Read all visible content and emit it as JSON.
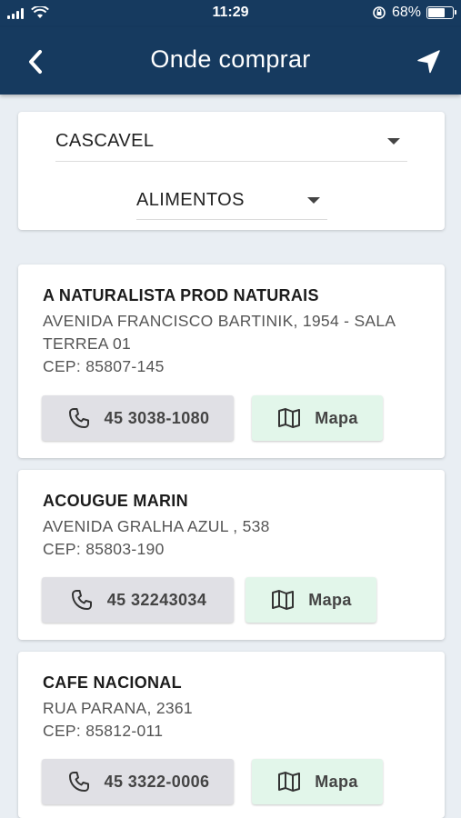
{
  "status_bar": {
    "time": "11:29",
    "battery": "68%",
    "battery_level": 0.68
  },
  "header": {
    "title": "Onde comprar",
    "back_icon": "chevron-left-icon",
    "location_icon": "navigation-arrow-icon"
  },
  "filters": {
    "city": "CASCAVEL",
    "category": "ALIMENTOS"
  },
  "stores": [
    {
      "name": "A NATURALISTA PROD NATURAIS",
      "address_line1": "AVENIDA FRANCISCO BARTINIK,  1954 - SALA",
      "address_line2": "TERREA 01",
      "cep": "CEP: 85807-145",
      "phone": "45 3038-1080",
      "map_label": "Mapa"
    },
    {
      "name": "ACOUGUE MARIN",
      "address_line1": "AVENIDA GRALHA AZUL ,  538",
      "address_line2": "",
      "cep": "CEP: 85803-190",
      "phone": "45 32243034",
      "map_label": "Mapa"
    },
    {
      "name": "CAFE NACIONAL",
      "address_line1": "RUA PARANA,  2361",
      "address_line2": "",
      "cep": "CEP: 85812-011",
      "phone": "45 3322-0006",
      "map_label": "Mapa"
    }
  ]
}
